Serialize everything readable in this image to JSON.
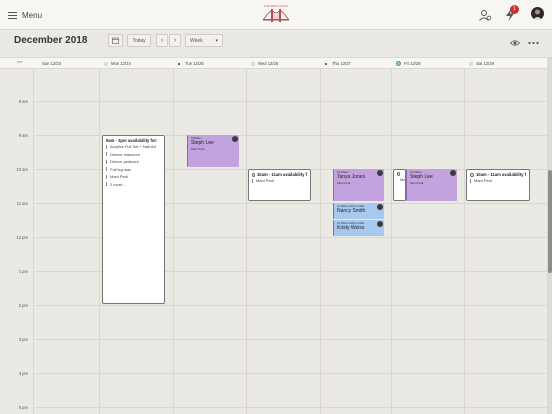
{
  "header": {
    "menu_label": "Menu",
    "logo_text": "GOLDEN GATE",
    "notification_count": "1"
  },
  "toolbar": {
    "month_title": "December 2018",
    "today_label": "Today",
    "view_label": "Week"
  },
  "timezone": "PST",
  "days": [
    {
      "label": "Sun 12/23"
    },
    {
      "label": "Mon 12/24"
    },
    {
      "label": "Tue 12/25"
    },
    {
      "label": "Wed 12/26"
    },
    {
      "label": "Thu 12/27"
    },
    {
      "label": "Fri 12/28"
    },
    {
      "label": "Sat 12/29"
    }
  ],
  "hours": [
    "8 am",
    "9 am",
    "10 am",
    "11 am",
    "12 pm",
    "1 pm",
    "2 pm",
    "3 pm",
    "4 pm",
    "5 pm"
  ],
  "events": {
    "mon_avail": {
      "title": "9am - 2pm availability for:",
      "services": [
        "Acrylics Full Set + Nail Art",
        "Deluxe manicure",
        "Deluxe pedicure",
        "Full leg wax",
        "Mani Pedi"
      ],
      "more": "2 more..."
    },
    "tue_appt": {
      "time": "9:00am",
      "name": "Steph Lee",
      "service": "Mani Pedi"
    },
    "wed_avail": {
      "title": "10am - 11am availability f",
      "service": "Mani Pedi"
    },
    "thu_appt1": {
      "time": "10:00am",
      "name": "Tanya Jones",
      "service": "Mani Pedi"
    },
    "thu_appt2": {
      "time": "11:00am-00min Max",
      "name": "Nancy Smith"
    },
    "thu_appt3": {
      "time": "11:30am-00min Max",
      "name": "Kristy Weiss"
    },
    "fri_avail": {
      "service": "Ma"
    },
    "fri_appt": {
      "time": "10:00am",
      "name": "Steph Lee",
      "service": "Mani Pedi"
    },
    "sat_avail": {
      "title": "10am - 11am availability f",
      "service": "Mani Pedi"
    }
  },
  "colors": {
    "appointment_purple": "#c2a3e0",
    "appointment_blue": "#a8c8ee",
    "notification_red": "#c9302c",
    "logo_red": "#b2534a"
  }
}
